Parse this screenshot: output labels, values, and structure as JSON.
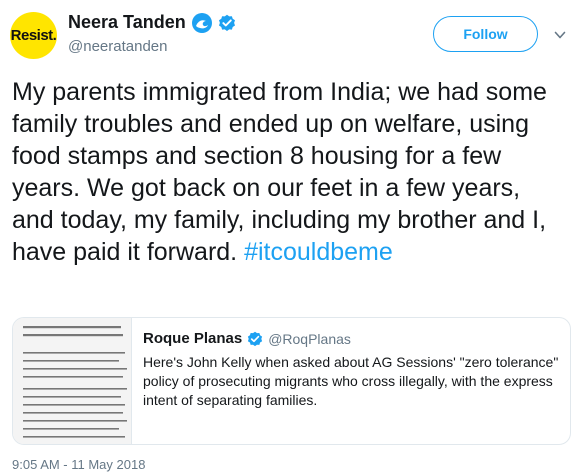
{
  "author": {
    "avatar_text": "Resist.",
    "display_name": "Neera Tanden",
    "handle": "@neeratanden",
    "badge_icons": [
      "wave-icon",
      "verified-icon"
    ]
  },
  "follow_button": {
    "label": "Follow"
  },
  "menu": {
    "icon": "chevron-down-icon"
  },
  "tweet": {
    "text": "My parents immigrated from India; we had some family troubles and ended up on welfare, using food stamps and section 8 housing for a few years. We got back on our feet in a few years, and today, my family, including my brother and I, have paid it forward. ",
    "hashtag": "#itcouldbeme"
  },
  "quoted_tweet": {
    "display_name": "Roque Planas",
    "handle": "@RoqPlanas",
    "text": "Here's John Kelly when asked about AG Sessions' \"zero tolerance\" policy of prosecuting migrants who cross illegally, with the express intent of separating families."
  },
  "timestamp": "9:05 AM - 11 May 2018",
  "colors": {
    "accent": "#1da1f2",
    "secondary_text": "#657786",
    "avatar_bg": "#ffe500",
    "border": "#e1e8ed"
  }
}
